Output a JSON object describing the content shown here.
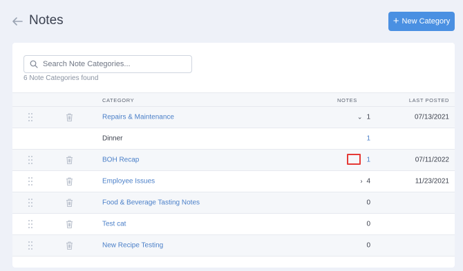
{
  "header": {
    "title": "Notes",
    "new_button_label": "New Category"
  },
  "search": {
    "placeholder": "Search Note Categories...",
    "value": "",
    "found_text": "6 Note Categories found"
  },
  "table": {
    "columns": {
      "category": "CATEGORY",
      "notes": "NOTES",
      "last_posted": "LAST POSTED"
    },
    "rows": [
      {
        "name": "Repairs & Maintenance",
        "notes": "1",
        "chevron": "down",
        "date": "07/13/2021"
      },
      {
        "name": "Dinner",
        "notes": "1",
        "chevron": "",
        "date": ""
      },
      {
        "name": "BOH Recap",
        "notes": "1",
        "chevron": "",
        "date": "07/11/2022"
      },
      {
        "name": "Employee Issues",
        "notes": "4",
        "chevron": "right",
        "date": "11/23/2021"
      },
      {
        "name": "Food & Beverage Tasting Notes",
        "notes": "0",
        "chevron": "",
        "date": ""
      },
      {
        "name": "Test cat",
        "notes": "0",
        "chevron": "",
        "date": ""
      },
      {
        "name": "New Recipe Testing",
        "notes": "0",
        "chevron": "",
        "date": ""
      }
    ]
  },
  "colors": {
    "accent": "#4a90e2",
    "link": "#4a7fc8",
    "highlight": "#e53935"
  }
}
